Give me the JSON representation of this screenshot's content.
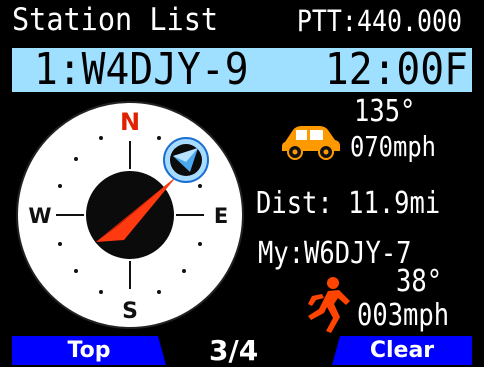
{
  "header": {
    "title": "Station List",
    "ptt": "PTT:440.000"
  },
  "station": {
    "index_call": "1:W4DJY-9",
    "time": "12:00F"
  },
  "compass": {
    "north": "N",
    "south": "S",
    "east": "E",
    "west": "W",
    "colors": {
      "north_label": "#e02000",
      "needle": "#ff3a10",
      "face": "#ffffff",
      "bezel": "#0b0b0b",
      "target_icon": "#58b8f0"
    }
  },
  "target": {
    "icon": "car-icon",
    "heading": "135°",
    "speed": "070mph"
  },
  "distance": "Dist: 11.9mi",
  "own": {
    "callsign": "My:W6DJY-7",
    "icon": "running-person-icon",
    "heading": "38°",
    "speed": "003mph"
  },
  "softkeys": {
    "left": "Top",
    "page": "3/4",
    "right": "Clear"
  },
  "colors": {
    "station_bar": "#9fdfff",
    "softkey": "#0000ff",
    "car": "#ff9900",
    "runner": "#ff4400"
  }
}
